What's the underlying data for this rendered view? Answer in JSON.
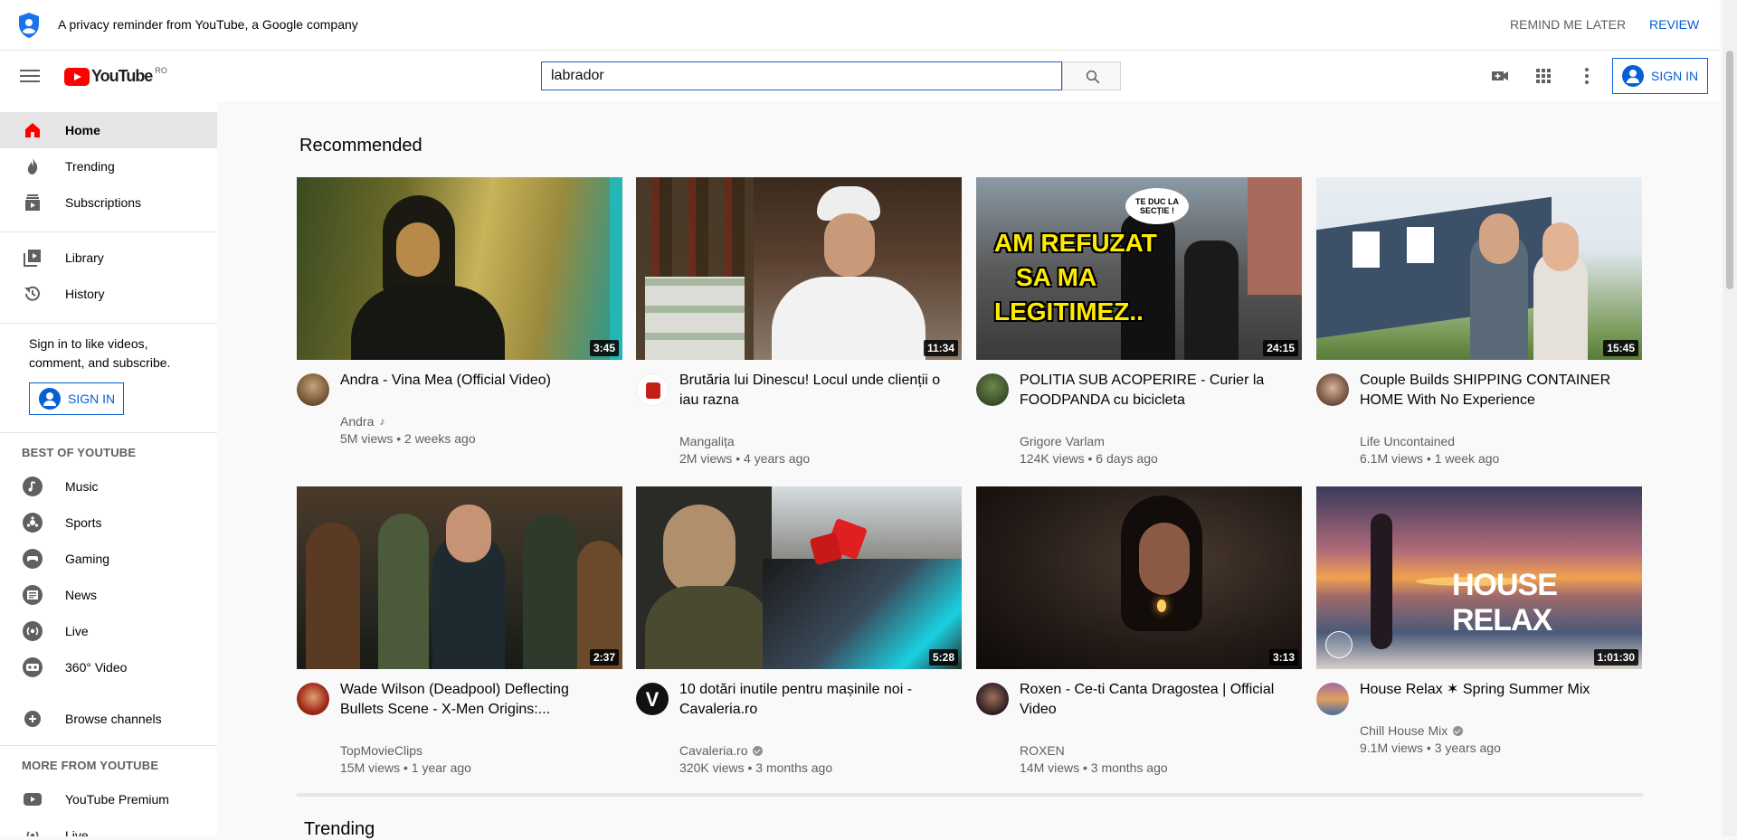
{
  "privacy": {
    "text": "A privacy reminder from YouTube, a Google company",
    "remind_later": "REMIND ME LATER",
    "review": "REVIEW"
  },
  "masthead": {
    "logo_text": "YouTube",
    "country": "RO",
    "search_value": "labrador",
    "sign_in": "SIGN IN",
    "icons": [
      "menu-icon",
      "video-camera-icon",
      "apps-grid-icon",
      "more-vert-icon"
    ]
  },
  "sidebar": {
    "main": [
      {
        "label": "Home",
        "icon": "home-icon"
      },
      {
        "label": "Trending",
        "icon": "trending-flame-icon"
      },
      {
        "label": "Subscriptions",
        "icon": "subscriptions-icon"
      }
    ],
    "library": [
      {
        "label": "Library",
        "icon": "library-icon"
      },
      {
        "label": "History",
        "icon": "history-icon"
      }
    ],
    "signin_prompt": "Sign in to like videos, comment, and subscribe.",
    "signin_button": "SIGN IN",
    "best_header": "BEST OF YOUTUBE",
    "best": [
      {
        "label": "Music",
        "icon": "music-icon"
      },
      {
        "label": "Sports",
        "icon": "sports-icon"
      },
      {
        "label": "Gaming",
        "icon": "gaming-icon"
      },
      {
        "label": "News",
        "icon": "news-icon"
      },
      {
        "label": "Live",
        "icon": "live-icon"
      },
      {
        "label": "360° Video",
        "icon": "360-video-icon"
      }
    ],
    "browse": {
      "label": "Browse channels",
      "icon": "add-circle-icon"
    },
    "more_header": "MORE FROM YOUTUBE",
    "more": [
      {
        "label": "YouTube Premium",
        "icon": "youtube-premium-icon"
      },
      {
        "label": "Live",
        "icon": "live-icon"
      }
    ]
  },
  "recommended": {
    "title": "Recommended",
    "videos": [
      {
        "title": "Andra - Vina Mea (Official Video)",
        "channel": "Andra",
        "channel_badge": "music-note",
        "meta": "5M views • 2 weeks ago",
        "duration": "3:45"
      },
      {
        "title": "Brutăria lui Dinescu! Locul unde clienții o iau razna",
        "channel": "Mangalița",
        "meta": "2M views • 4 years ago",
        "duration": "11:34"
      },
      {
        "title": "POLITIA SUB ACOPERIRE - Curier la FOODPANDA cu bicicleta",
        "channel": "Grigore Varlam",
        "meta": "124K views • 6 days ago",
        "duration": "24:15",
        "thumb_text_1": "AM REFUZAT",
        "thumb_text_2": "SA MA",
        "thumb_text_3": "LEGITIMEZ..",
        "thumb_bubble": "TE DUC LA SECȚIE !"
      },
      {
        "title": "Couple Builds SHIPPING CONTAINER HOME With No Experience",
        "channel": "Life Uncontained",
        "meta": "6.1M views • 1 week ago",
        "duration": "15:45"
      },
      {
        "title": "Wade Wilson (Deadpool) Deflecting Bullets Scene - X-Men Origins:...",
        "channel": "TopMovieClips",
        "meta": "15M views • 1 year ago",
        "duration": "2:37"
      },
      {
        "title": "10 dotări inutile pentru mașinile noi - Cavaleria.ro",
        "channel": "Cavaleria.ro",
        "verified": true,
        "meta": "320K views • 3 months ago",
        "duration": "5:28"
      },
      {
        "title": "Roxen - Ce-ti Canta Dragostea | Official Video",
        "channel": "ROXEN",
        "meta": "14M views • 3 months ago",
        "duration": "3:13"
      },
      {
        "title": "House Relax ✶ Spring Summer Mix",
        "channel": "Chill House Mix",
        "verified": true,
        "meta": "9.1M views • 3 years ago",
        "duration": "1:01:30",
        "thumb_text": "HOUSE RELAX"
      }
    ]
  },
  "trending": {
    "title": "Trending"
  },
  "colors": {
    "brand_red": "#ff0000",
    "link_blue": "#065fd4"
  }
}
